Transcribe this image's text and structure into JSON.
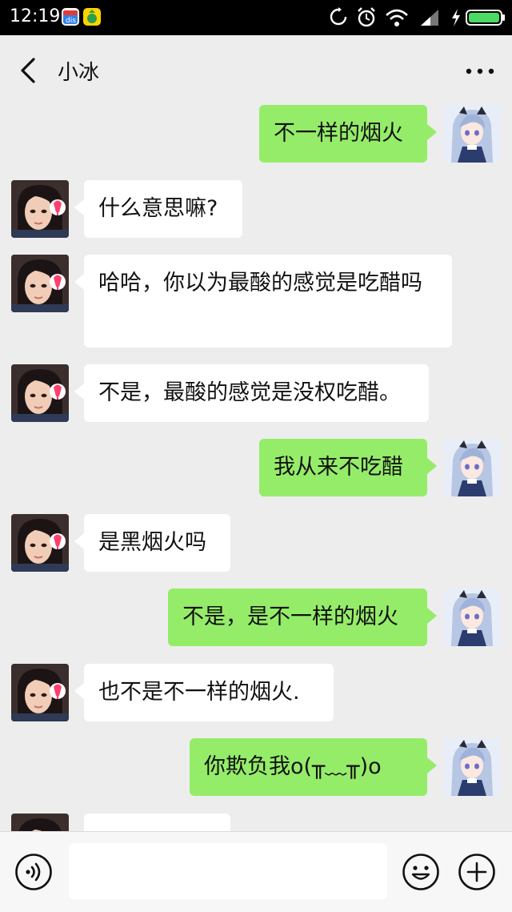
{
  "status_bar": {
    "time": "12:19",
    "app_icons": [
      "calendar-app-icon",
      "lucky-bag-app-icon"
    ],
    "right_icons": [
      "sync-icon",
      "alarm-icon",
      "wifi-icon",
      "signal-icon",
      "charging-icon",
      "battery-icon"
    ],
    "battery_color": "#4cd964"
  },
  "header": {
    "title": "小冰",
    "back_icon": "chevron-left-icon",
    "more_icon": "more-dots-icon"
  },
  "messages": [
    {
      "sender": "me",
      "text": "不一样的烟火"
    },
    {
      "sender": "bot",
      "text": "什么意思嘛?"
    },
    {
      "sender": "bot",
      "text": "哈哈，你以为最酸的感觉是吃醋吗"
    },
    {
      "sender": "bot",
      "text": "不是，最酸的感觉是没权吃醋。"
    },
    {
      "sender": "me",
      "text": "我从来不吃醋"
    },
    {
      "sender": "bot",
      "text": "是黑烟火吗"
    },
    {
      "sender": "me",
      "text": "不是，是不一样的烟火"
    },
    {
      "sender": "bot",
      "text": "也不是不一样的烟火."
    },
    {
      "sender": "me",
      "text": "你欺负我o(╥﹏╥)o"
    },
    {
      "sender": "bot",
      "text": ""
    }
  ],
  "colors": {
    "background": "#ededed",
    "my_bubble": "#95ec69",
    "bot_bubble": "#ffffff"
  },
  "input_bar": {
    "voice_icon": "voice-icon",
    "input_value": "",
    "emoji_icon": "emoji-icon",
    "plus_icon": "plus-icon"
  }
}
